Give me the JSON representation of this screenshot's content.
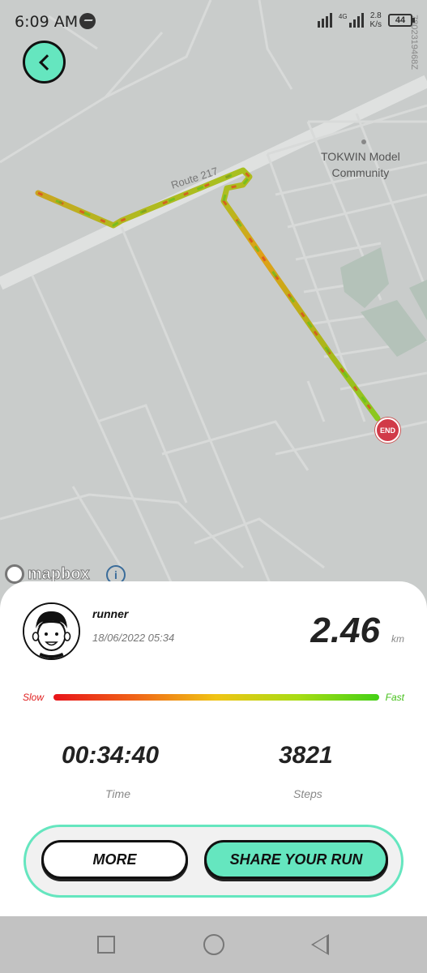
{
  "status_bar": {
    "time": "6:09 AM",
    "network_type": "4G",
    "net_speed_value": "2.8",
    "net_speed_unit": "K/s",
    "battery_level": "44"
  },
  "map": {
    "place_name_line1": "TOKWIN Model",
    "place_name_line2": "Community",
    "road_name": "Route 217",
    "map_id": "7802319468Z",
    "end_marker_label": "END",
    "attribution": "mapbox",
    "info_symbol": "i"
  },
  "run": {
    "username": "runner",
    "datetime": "18/06/2022 05:34",
    "distance": "2.46",
    "distance_unit": "km",
    "speed_scale": {
      "slow_label": "Slow",
      "fast_label": "Fast",
      "slow_color": "#e8141a",
      "fast_color": "#44d016"
    },
    "time_value": "00:34:40",
    "time_label": "Time",
    "steps_value": "3821",
    "steps_label": "Steps"
  },
  "actions": {
    "more_label": "MORE",
    "share_label": "SHARE YOUR RUN",
    "accent_color": "#65e6bf"
  },
  "nav_bar": {
    "recents_icon": "square-icon",
    "home_icon": "circle-icon",
    "back_icon": "triangle-back-icon"
  }
}
